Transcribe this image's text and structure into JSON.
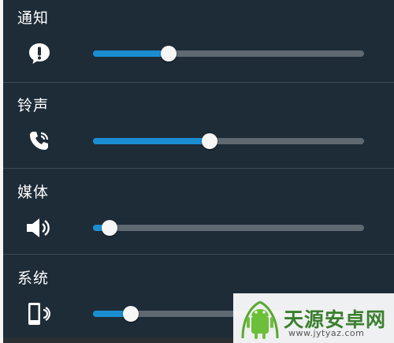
{
  "volume_panel": {
    "sections": [
      {
        "label": "通知",
        "icon": "notification-alert-icon",
        "level": 0.28
      },
      {
        "label": "铃声",
        "icon": "ringtone-phone-icon",
        "level": 0.43
      },
      {
        "label": "媒体",
        "icon": "speaker-icon",
        "level": 0.06
      },
      {
        "label": "系统",
        "icon": "phone-vibrate-icon",
        "level": 0.14
      }
    ],
    "colors": {
      "background": "#1e2c38",
      "track": "#5f6971",
      "fill": "#1b8ed2",
      "thumb": "#f6f6f6"
    }
  },
  "watermark": {
    "brand": "天源安卓网",
    "url": "www.jytyaz.com"
  }
}
